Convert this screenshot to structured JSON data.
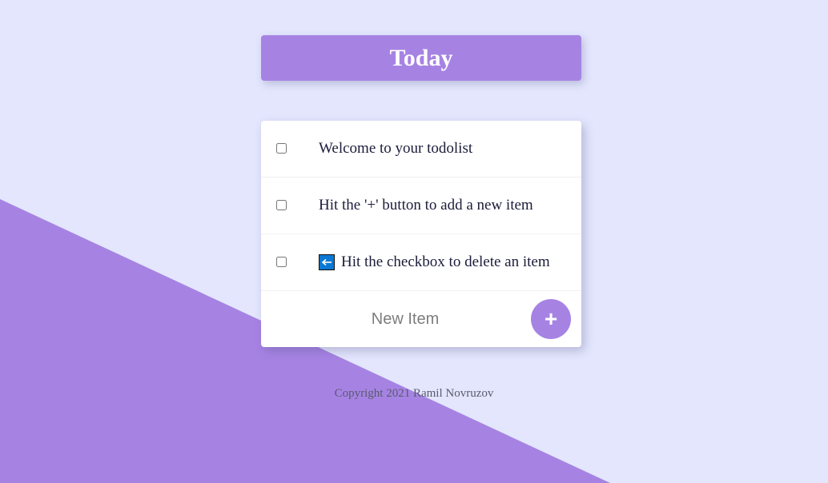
{
  "colors": {
    "background": "#e3e6fd",
    "accent": "#a683e3",
    "card": "#ffffff",
    "text": "#1b1d3a",
    "arrow_icon_bg": "#0a78d4"
  },
  "header": {
    "title": "Today"
  },
  "todo_list": {
    "items": [
      {
        "label": "Welcome to your todolist",
        "checked": false
      },
      {
        "label": "Hit the '+' button to add a new item",
        "checked": false
      },
      {
        "label": "Hit the checkbox to delete an item",
        "checked": false,
        "icon": "left-arrow-icon"
      }
    ],
    "new_item": {
      "placeholder": "New Item",
      "value": ""
    },
    "add_button_label": "+"
  },
  "footer": {
    "copyright": "Copyright 2021 Ramil Novruzov"
  }
}
